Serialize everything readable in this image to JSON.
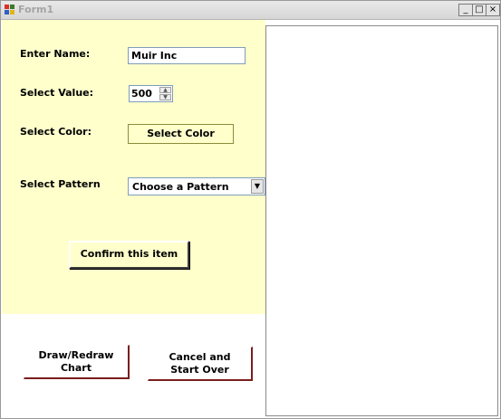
{
  "window": {
    "title": "Form1",
    "minimize": "_",
    "maximize": "□",
    "close": "×"
  },
  "form": {
    "name_label": "Enter Name:",
    "name_value": "Muir Inc",
    "value_label": "Select Value:",
    "value_value": "500",
    "color_label": "Select Color:",
    "color_button": "Select Color",
    "pattern_label": "Select Pattern",
    "pattern_selected": "Choose a Pattern",
    "confirm_button": "Confirm this item"
  },
  "actions": {
    "draw_line1": "Draw/Redraw",
    "draw_line2": "Chart",
    "cancel_line1": "Cancel and",
    "cancel_line2": "Start Over"
  }
}
